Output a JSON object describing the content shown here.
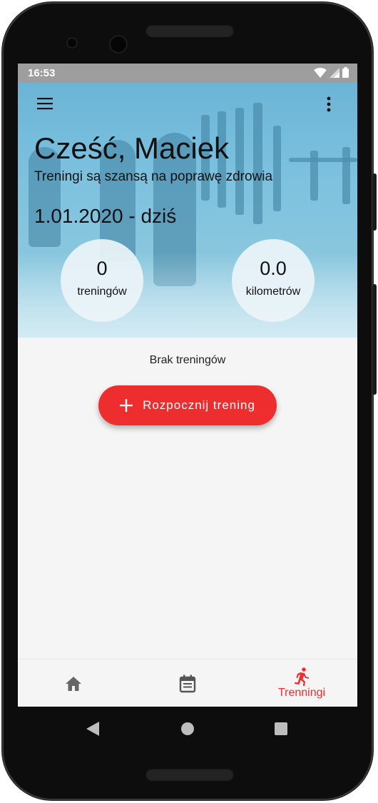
{
  "status_bar": {
    "time": "16:53"
  },
  "header": {
    "greeting": "Cześć, Maciek",
    "subtitle": "Treningi są szansą na poprawę zdrowia",
    "date_range": "1.01.2020 - dziś",
    "menu_icon": "hamburger-menu-icon",
    "more_icon": "more-vert-icon"
  },
  "stats": [
    {
      "value": "0",
      "label": "treningów"
    },
    {
      "value": "0.0",
      "label": "kilometrów"
    }
  ],
  "main": {
    "empty_text": "Brak treningów",
    "start_button_label": "Rozpocznij trening",
    "start_button_icon": "plus-icon"
  },
  "bottom_nav": {
    "items": [
      {
        "icon": "home-icon",
        "label": ""
      },
      {
        "icon": "calendar-icon",
        "label": ""
      },
      {
        "icon": "running-icon",
        "label": "Trenningi",
        "active": true
      }
    ]
  },
  "colors": {
    "accent": "#ee2d2f",
    "hero": "#7ec2df",
    "background": "#f5f5f5"
  }
}
